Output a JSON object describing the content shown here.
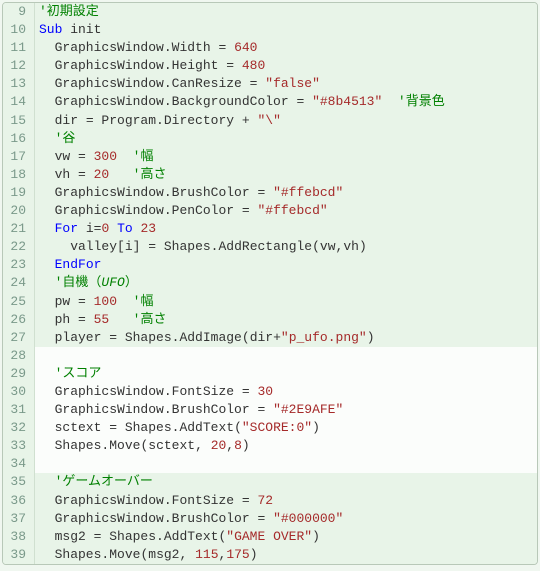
{
  "language": "smallbasic",
  "colors": {
    "comment": "#008000",
    "keyword": "#0000ff",
    "number_string": "#a52a2a",
    "default": "#333333",
    "gutter_bg": "#e8f4e8",
    "editor_bg": "#fbfdfb",
    "highlight_bg": "#e8f4e8"
  },
  "highlighted_lines": [
    9,
    10,
    11,
    12,
    13,
    14,
    15,
    16,
    17,
    18,
    19,
    20,
    21,
    22,
    23,
    24,
    25,
    26,
    27,
    35,
    36,
    37,
    38,
    39
  ],
  "lines": [
    {
      "n": 9,
      "tokens": [
        {
          "t": "'初期設定",
          "c": "comment"
        }
      ]
    },
    {
      "n": 10,
      "tokens": [
        {
          "t": "Sub",
          "c": "keyword"
        },
        {
          "t": " init",
          "c": "ident"
        }
      ]
    },
    {
      "n": 11,
      "tokens": [
        {
          "t": "  GraphicsWindow",
          "c": "obj"
        },
        {
          "t": ".",
          "c": "op"
        },
        {
          "t": "Width",
          "c": "ident"
        },
        {
          "t": " = ",
          "c": "op"
        },
        {
          "t": "640",
          "c": "number"
        }
      ]
    },
    {
      "n": 12,
      "tokens": [
        {
          "t": "  GraphicsWindow",
          "c": "obj"
        },
        {
          "t": ".",
          "c": "op"
        },
        {
          "t": "Height",
          "c": "ident"
        },
        {
          "t": " = ",
          "c": "op"
        },
        {
          "t": "480",
          "c": "number"
        }
      ]
    },
    {
      "n": 13,
      "tokens": [
        {
          "t": "  GraphicsWindow",
          "c": "obj"
        },
        {
          "t": ".",
          "c": "op"
        },
        {
          "t": "CanResize",
          "c": "ident"
        },
        {
          "t": " = ",
          "c": "op"
        },
        {
          "t": "\"false\"",
          "c": "string"
        }
      ]
    },
    {
      "n": 14,
      "tokens": [
        {
          "t": "  GraphicsWindow",
          "c": "obj"
        },
        {
          "t": ".",
          "c": "op"
        },
        {
          "t": "BackgroundColor",
          "c": "ident"
        },
        {
          "t": " = ",
          "c": "op"
        },
        {
          "t": "\"#8b4513\"",
          "c": "string"
        },
        {
          "t": "  ",
          "c": "op"
        },
        {
          "t": "'背景色",
          "c": "comment"
        }
      ]
    },
    {
      "n": 15,
      "tokens": [
        {
          "t": "  dir",
          "c": "ident"
        },
        {
          "t": " = ",
          "c": "op"
        },
        {
          "t": "Program",
          "c": "obj"
        },
        {
          "t": ".",
          "c": "op"
        },
        {
          "t": "Directory",
          "c": "ident"
        },
        {
          "t": " + ",
          "c": "op"
        },
        {
          "t": "\"\\\"",
          "c": "string"
        }
      ]
    },
    {
      "n": 16,
      "tokens": [
        {
          "t": "  ",
          "c": "op"
        },
        {
          "t": "'谷",
          "c": "comment"
        }
      ]
    },
    {
      "n": 17,
      "tokens": [
        {
          "t": "  vw",
          "c": "ident"
        },
        {
          "t": " = ",
          "c": "op"
        },
        {
          "t": "300",
          "c": "number"
        },
        {
          "t": "  ",
          "c": "op"
        },
        {
          "t": "'幅",
          "c": "comment"
        }
      ]
    },
    {
      "n": 18,
      "tokens": [
        {
          "t": "  vh",
          "c": "ident"
        },
        {
          "t": " = ",
          "c": "op"
        },
        {
          "t": "20",
          "c": "number"
        },
        {
          "t": "   ",
          "c": "op"
        },
        {
          "t": "'高さ",
          "c": "comment"
        }
      ]
    },
    {
      "n": 19,
      "tokens": [
        {
          "t": "  GraphicsWindow",
          "c": "obj"
        },
        {
          "t": ".",
          "c": "op"
        },
        {
          "t": "BrushColor",
          "c": "ident"
        },
        {
          "t": " = ",
          "c": "op"
        },
        {
          "t": "\"#ffebcd\"",
          "c": "string"
        }
      ]
    },
    {
      "n": 20,
      "tokens": [
        {
          "t": "  GraphicsWindow",
          "c": "obj"
        },
        {
          "t": ".",
          "c": "op"
        },
        {
          "t": "PenColor",
          "c": "ident"
        },
        {
          "t": " = ",
          "c": "op"
        },
        {
          "t": "\"#ffebcd\"",
          "c": "string"
        }
      ]
    },
    {
      "n": 21,
      "tokens": [
        {
          "t": "  ",
          "c": "op"
        },
        {
          "t": "For",
          "c": "keyword"
        },
        {
          "t": " i",
          "c": "ident"
        },
        {
          "t": "=",
          "c": "op"
        },
        {
          "t": "0",
          "c": "number"
        },
        {
          "t": " ",
          "c": "op"
        },
        {
          "t": "To",
          "c": "keyword"
        },
        {
          "t": " ",
          "c": "op"
        },
        {
          "t": "23",
          "c": "number"
        }
      ]
    },
    {
      "n": 22,
      "tokens": [
        {
          "t": "    valley",
          "c": "ident"
        },
        {
          "t": "[",
          "c": "op"
        },
        {
          "t": "i",
          "c": "ident"
        },
        {
          "t": "] = ",
          "c": "op"
        },
        {
          "t": "Shapes",
          "c": "obj"
        },
        {
          "t": ".",
          "c": "op"
        },
        {
          "t": "AddRectangle",
          "c": "ident"
        },
        {
          "t": "(",
          "c": "op"
        },
        {
          "t": "vw",
          "c": "ident"
        },
        {
          "t": ",",
          "c": "op"
        },
        {
          "t": "vh",
          "c": "ident"
        },
        {
          "t": ")",
          "c": "op"
        }
      ]
    },
    {
      "n": 23,
      "tokens": [
        {
          "t": "  ",
          "c": "op"
        },
        {
          "t": "EndFor",
          "c": "keyword"
        }
      ]
    },
    {
      "n": 24,
      "tokens": [
        {
          "t": "  ",
          "c": "op"
        },
        {
          "t": "'自機（",
          "c": "comment"
        },
        {
          "t": "UFO",
          "c": "comment-it"
        },
        {
          "t": "）",
          "c": "comment"
        }
      ]
    },
    {
      "n": 25,
      "tokens": [
        {
          "t": "  pw",
          "c": "ident"
        },
        {
          "t": " = ",
          "c": "op"
        },
        {
          "t": "100",
          "c": "number"
        },
        {
          "t": "  ",
          "c": "op"
        },
        {
          "t": "'幅",
          "c": "comment"
        }
      ]
    },
    {
      "n": 26,
      "tokens": [
        {
          "t": "  ph",
          "c": "ident"
        },
        {
          "t": " = ",
          "c": "op"
        },
        {
          "t": "55",
          "c": "number"
        },
        {
          "t": "   ",
          "c": "op"
        },
        {
          "t": "'高さ",
          "c": "comment"
        }
      ]
    },
    {
      "n": 27,
      "tokens": [
        {
          "t": "  player",
          "c": "ident"
        },
        {
          "t": " = ",
          "c": "op"
        },
        {
          "t": "Shapes",
          "c": "obj"
        },
        {
          "t": ".",
          "c": "op"
        },
        {
          "t": "AddImage",
          "c": "ident"
        },
        {
          "t": "(",
          "c": "op"
        },
        {
          "t": "dir",
          "c": "ident"
        },
        {
          "t": "+",
          "c": "op"
        },
        {
          "t": "\"p_ufo.png\"",
          "c": "string"
        },
        {
          "t": ")",
          "c": "op"
        }
      ]
    },
    {
      "n": 28,
      "tokens": [
        {
          "t": " ",
          "c": "op"
        }
      ]
    },
    {
      "n": 29,
      "tokens": [
        {
          "t": "  ",
          "c": "op"
        },
        {
          "t": "'スコア",
          "c": "comment"
        }
      ]
    },
    {
      "n": 30,
      "tokens": [
        {
          "t": "  GraphicsWindow",
          "c": "obj"
        },
        {
          "t": ".",
          "c": "op"
        },
        {
          "t": "FontSize",
          "c": "ident"
        },
        {
          "t": " = ",
          "c": "op"
        },
        {
          "t": "30",
          "c": "number"
        }
      ]
    },
    {
      "n": 31,
      "tokens": [
        {
          "t": "  GraphicsWindow",
          "c": "obj"
        },
        {
          "t": ".",
          "c": "op"
        },
        {
          "t": "BrushColor",
          "c": "ident"
        },
        {
          "t": " = ",
          "c": "op"
        },
        {
          "t": "\"#2E9AFE\"",
          "c": "string"
        }
      ]
    },
    {
      "n": 32,
      "tokens": [
        {
          "t": "  sctext",
          "c": "ident"
        },
        {
          "t": " = ",
          "c": "op"
        },
        {
          "t": "Shapes",
          "c": "obj"
        },
        {
          "t": ".",
          "c": "op"
        },
        {
          "t": "AddText",
          "c": "ident"
        },
        {
          "t": "(",
          "c": "op"
        },
        {
          "t": "\"SCORE:0\"",
          "c": "string"
        },
        {
          "t": ")",
          "c": "op"
        }
      ]
    },
    {
      "n": 33,
      "tokens": [
        {
          "t": "  Shapes",
          "c": "obj"
        },
        {
          "t": ".",
          "c": "op"
        },
        {
          "t": "Move",
          "c": "ident"
        },
        {
          "t": "(",
          "c": "op"
        },
        {
          "t": "sctext",
          "c": "ident"
        },
        {
          "t": ", ",
          "c": "op"
        },
        {
          "t": "20",
          "c": "number"
        },
        {
          "t": ",",
          "c": "op"
        },
        {
          "t": "8",
          "c": "number"
        },
        {
          "t": ")",
          "c": "op"
        }
      ]
    },
    {
      "n": 34,
      "tokens": [
        {
          "t": " ",
          "c": "op"
        }
      ]
    },
    {
      "n": 35,
      "tokens": [
        {
          "t": "  ",
          "c": "op"
        },
        {
          "t": "'ゲームオーバー",
          "c": "comment"
        }
      ]
    },
    {
      "n": 36,
      "tokens": [
        {
          "t": "  GraphicsWindow",
          "c": "obj"
        },
        {
          "t": ".",
          "c": "op"
        },
        {
          "t": "FontSize",
          "c": "ident"
        },
        {
          "t": " = ",
          "c": "op"
        },
        {
          "t": "72",
          "c": "number"
        }
      ]
    },
    {
      "n": 37,
      "tokens": [
        {
          "t": "  GraphicsWindow",
          "c": "obj"
        },
        {
          "t": ".",
          "c": "op"
        },
        {
          "t": "BrushColor",
          "c": "ident"
        },
        {
          "t": " = ",
          "c": "op"
        },
        {
          "t": "\"#000000\"",
          "c": "string"
        }
      ]
    },
    {
      "n": 38,
      "tokens": [
        {
          "t": "  msg2",
          "c": "ident"
        },
        {
          "t": " = ",
          "c": "op"
        },
        {
          "t": "Shapes",
          "c": "obj"
        },
        {
          "t": ".",
          "c": "op"
        },
        {
          "t": "AddText",
          "c": "ident"
        },
        {
          "t": "(",
          "c": "op"
        },
        {
          "t": "\"GAME OVER\"",
          "c": "string"
        },
        {
          "t": ")",
          "c": "op"
        }
      ]
    },
    {
      "n": 39,
      "tokens": [
        {
          "t": "  Shapes",
          "c": "obj"
        },
        {
          "t": ".",
          "c": "op"
        },
        {
          "t": "Move",
          "c": "ident"
        },
        {
          "t": "(",
          "c": "op"
        },
        {
          "t": "msg2",
          "c": "ident"
        },
        {
          "t": ", ",
          "c": "op"
        },
        {
          "t": "115",
          "c": "number"
        },
        {
          "t": ",",
          "c": "op"
        },
        {
          "t": "175",
          "c": "number"
        },
        {
          "t": ")",
          "c": "op"
        }
      ]
    }
  ]
}
